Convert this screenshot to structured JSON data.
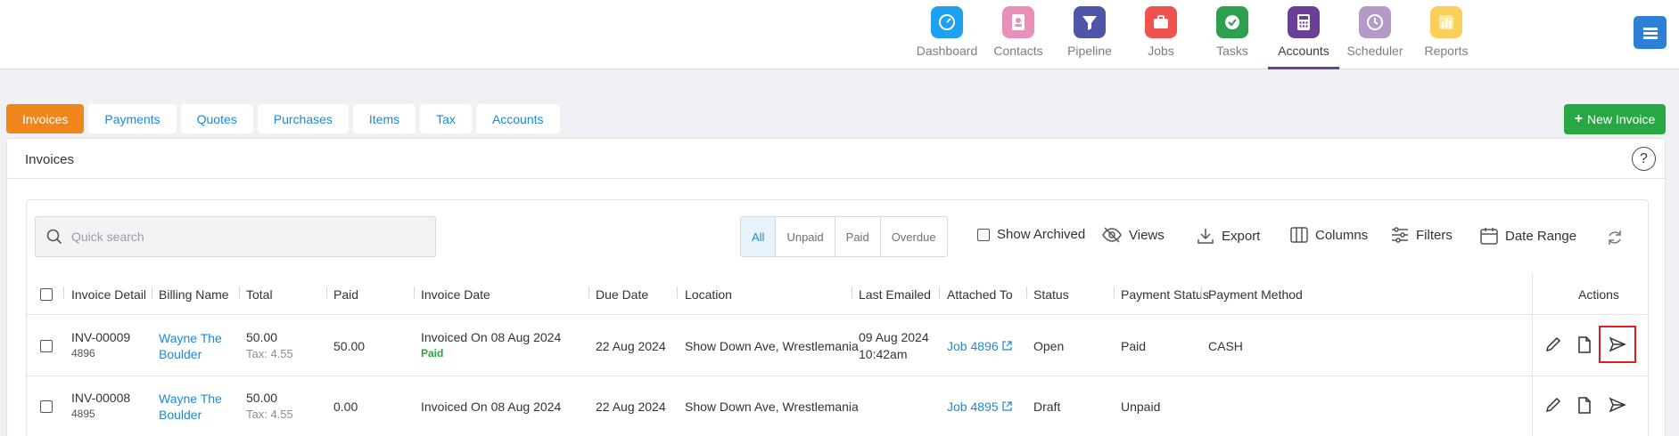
{
  "nav": {
    "items": [
      {
        "label": "Dashboard",
        "color": "#1ea1f2",
        "icon": "gauge-icon"
      },
      {
        "label": "Contacts",
        "color": "#e88fba",
        "icon": "contact-book-icon"
      },
      {
        "label": "Pipeline",
        "color": "#4e56a8",
        "icon": "funnel-icon"
      },
      {
        "label": "Jobs",
        "color": "#ef5350",
        "icon": "briefcase-icon"
      },
      {
        "label": "Tasks",
        "color": "#2e9e4f",
        "icon": "check-circle-icon"
      },
      {
        "label": "Accounts",
        "color": "#6a3f96",
        "icon": "calculator-icon"
      },
      {
        "label": "Scheduler",
        "color": "#b49ac8",
        "icon": "clock-icon"
      },
      {
        "label": "Reports",
        "color": "#f9cf5a",
        "icon": "bar-chart-icon"
      }
    ],
    "active": "Accounts"
  },
  "tabs": [
    "Invoices",
    "Payments",
    "Quotes",
    "Purchases",
    "Items",
    "Tax",
    "Accounts"
  ],
  "active_tab": "Invoices",
  "new_invoice_label": "New Invoice",
  "panel_title": "Invoices",
  "help_label": "?",
  "search": {
    "placeholder": "Quick search"
  },
  "filters": [
    "All",
    "Unpaid",
    "Paid",
    "Overdue"
  ],
  "active_filter": "All",
  "toolbar": {
    "show_archived": "Show Archived",
    "views": "Views",
    "export": "Export",
    "columns": "Columns",
    "filters": "Filters",
    "date_range": "Date Range"
  },
  "columns": [
    "Invoice Detail",
    "Billing Name",
    "Total",
    "Paid",
    "Invoice Date",
    "Due Date",
    "Location",
    "Last Emailed",
    "Attached To",
    "Status",
    "Payment Status",
    "Payment Method",
    "Actions"
  ],
  "rows": [
    {
      "invoice_no": "INV-00009",
      "invoice_id": "4896",
      "billing_name": "Wayne The Boulder",
      "total": "50.00",
      "tax": "Tax: 4.55",
      "paid": "50.00",
      "invoice_date": "Invoiced On 08 Aug 2024",
      "paid_tag": "Paid",
      "due_date": "22 Aug 2024",
      "location": "Show Down Ave, Wrestlemania",
      "last_emailed_date": "09 Aug 2024",
      "last_emailed_time": "10:42am",
      "attached_to": "Job 4896",
      "status": "Open",
      "payment_status": "Paid",
      "payment_method": "CASH"
    },
    {
      "invoice_no": "INV-00008",
      "invoice_id": "4895",
      "billing_name": "Wayne The Boulder",
      "total": "50.00",
      "tax": "Tax: 4.55",
      "paid": "0.00",
      "invoice_date": "Invoiced On 08 Aug 2024",
      "paid_tag": "",
      "due_date": "22 Aug 2024",
      "location": "Show Down Ave, Wrestlemania",
      "last_emailed_date": "",
      "last_emailed_time": "",
      "attached_to": "Job 4895",
      "status": "Draft",
      "payment_status": "Unpaid",
      "payment_method": ""
    }
  ]
}
